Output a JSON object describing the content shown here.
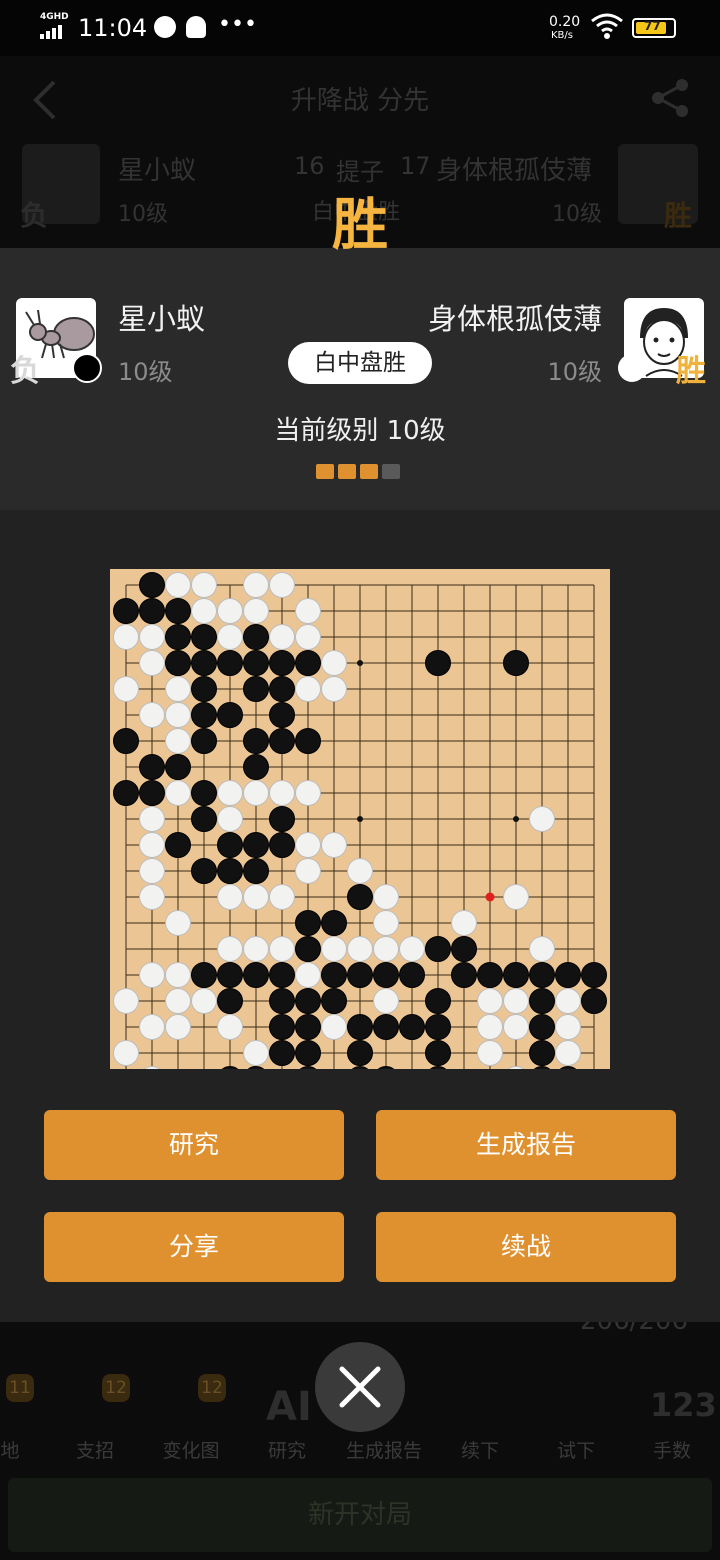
{
  "status_bar": {
    "network": "4GHD",
    "time": "11:04",
    "speed_value": "0.20",
    "speed_unit": "KB/s",
    "battery": "77"
  },
  "bg_header": {
    "title": "升降战 分先",
    "player_left": "星小蚁",
    "player_right": "身体根孤伎薄",
    "level_left": "10级",
    "level_right": "10级",
    "move_left": "16",
    "captures_label": "提子",
    "move_right": "17",
    "result_dim": "白中盘胜",
    "tag_fu": "负",
    "tag_win": "胜"
  },
  "banner": {
    "win_label": "胜"
  },
  "players": {
    "left": {
      "name": "星小蚁",
      "level": "10级",
      "tag": "负",
      "stone": "black"
    },
    "right": {
      "name": "身体根孤伎薄",
      "level": "10级",
      "tag": "胜",
      "stone": "white"
    }
  },
  "result": "白中盘胜",
  "current_level": "当前级别 10级",
  "level_progress": {
    "filled": 3,
    "total": 4
  },
  "colors": {
    "accent": "#e0912f",
    "progress_on": "#e0912f",
    "progress_off": "#5a5a5a",
    "board": "#ecc594"
  },
  "board": {
    "size": 19,
    "last_move": {
      "row": 12,
      "col": 14
    },
    "rows": [
      ".BWW.WW............",
      "BBBWWW.W...........",
      "WWBBWBWW...........",
      ".WBBBBBBW...B..B...",
      "W.WB.BBWW..........",
      ".WWBB.B............",
      "B.WB.BBB...........",
      ".BB..B.............",
      "BBWBWWWW...........",
      ".W.BW.B.........W..",
      ".WB.BBBWW..........",
      ".W.BBB.W.W.........",
      ".W..WWW..BW....W...",
      "..W....BB.W..W.....",
      "....WWWBWWWWBB..W..",
      ".WWBBBBWBBBB.BBBBBB",
      "W.WWB.BBB.W.B.WWBWB",
      ".WW.W.BBWBBBB.WWBW.",
      "W....WBB.B..B.W.BW.",
      ".W..BB.B.BB.B..WBB."
    ]
  },
  "buttons": {
    "study": "研究",
    "report": "生成报告",
    "share": "分享",
    "continue": "续战"
  },
  "bg_controls": {
    "move_counter": "206/206"
  },
  "bottom_nav": [
    {
      "label": "地",
      "badge": "11"
    },
    {
      "label": "支招",
      "badge": "12"
    },
    {
      "label": "变化图",
      "badge": "12"
    },
    {
      "label": "研究",
      "badge": ""
    },
    {
      "label": "生成报告",
      "badge": ""
    },
    {
      "label": "续下",
      "badge": ""
    },
    {
      "label": "试下",
      "badge": ""
    },
    {
      "label": "手数",
      "badge": ""
    }
  ],
  "bottom_nav_icons": {
    "ai": "AI",
    "moves": "123"
  },
  "new_game": "新开对局"
}
